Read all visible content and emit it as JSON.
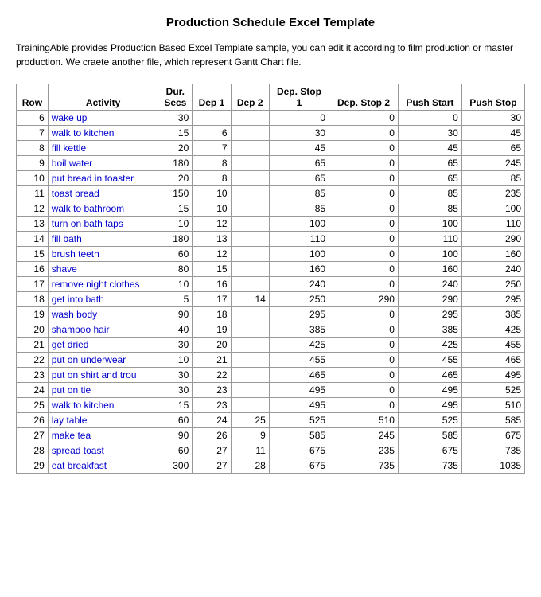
{
  "page": {
    "title": "Production Schedule Excel Template",
    "description": "TrainingAble provides Production Based Excel Template sample, you can edit it according to film production or master production. We craete another file, which represent Gantt Chart file."
  },
  "table": {
    "columns": [
      "Row",
      "Activity",
      "Dur. Secs",
      "Dep 1",
      "Dep 2",
      "Dep. Stop 1",
      "Dep. Stop 2",
      "Push Start",
      "Push Stop"
    ],
    "rows": [
      [
        6,
        "wake up",
        30,
        "",
        "",
        0,
        0,
        0,
        30
      ],
      [
        7,
        "walk to kitchen",
        15,
        6,
        "",
        30,
        0,
        30,
        45
      ],
      [
        8,
        "fill kettle",
        20,
        7,
        "",
        45,
        0,
        45,
        65
      ],
      [
        9,
        "boil water",
        180,
        8,
        "",
        65,
        0,
        65,
        245
      ],
      [
        10,
        "put bread in toaster",
        20,
        8,
        "",
        65,
        0,
        65,
        85
      ],
      [
        11,
        "toast bread",
        150,
        10,
        "",
        85,
        0,
        85,
        235
      ],
      [
        12,
        "walk to bathroom",
        15,
        10,
        "",
        85,
        0,
        85,
        100
      ],
      [
        13,
        "turn on bath taps",
        10,
        12,
        "",
        100,
        0,
        100,
        110
      ],
      [
        14,
        "fill bath",
        180,
        13,
        "",
        110,
        0,
        110,
        290
      ],
      [
        15,
        "brush teeth",
        60,
        12,
        "",
        100,
        0,
        100,
        160
      ],
      [
        16,
        "shave",
        80,
        15,
        "",
        160,
        0,
        160,
        240
      ],
      [
        17,
        "remove night clothes",
        10,
        16,
        "",
        240,
        0,
        240,
        250
      ],
      [
        18,
        "get into bath",
        5,
        17,
        14,
        250,
        290,
        290,
        295
      ],
      [
        19,
        "wash body",
        90,
        18,
        "",
        295,
        0,
        295,
        385
      ],
      [
        20,
        "shampoo hair",
        40,
        19,
        "",
        385,
        0,
        385,
        425
      ],
      [
        21,
        "get dried",
        30,
        20,
        "",
        425,
        0,
        425,
        455
      ],
      [
        22,
        "put on underwear",
        10,
        21,
        "",
        455,
        0,
        455,
        465
      ],
      [
        23,
        "put on shirt and trou",
        30,
        22,
        "",
        465,
        0,
        465,
        495
      ],
      [
        24,
        "put on tie",
        30,
        23,
        "",
        495,
        0,
        495,
        525
      ],
      [
        25,
        "walk to kitchen",
        15,
        23,
        "",
        495,
        0,
        495,
        510
      ],
      [
        26,
        "lay table",
        60,
        24,
        25,
        525,
        510,
        525,
        585
      ],
      [
        27,
        "make tea",
        90,
        26,
        9,
        585,
        245,
        585,
        675
      ],
      [
        28,
        "spread toast",
        60,
        27,
        11,
        675,
        235,
        675,
        735
      ],
      [
        29,
        "eat breakfast",
        300,
        27,
        28,
        675,
        735,
        735,
        1035
      ]
    ]
  }
}
